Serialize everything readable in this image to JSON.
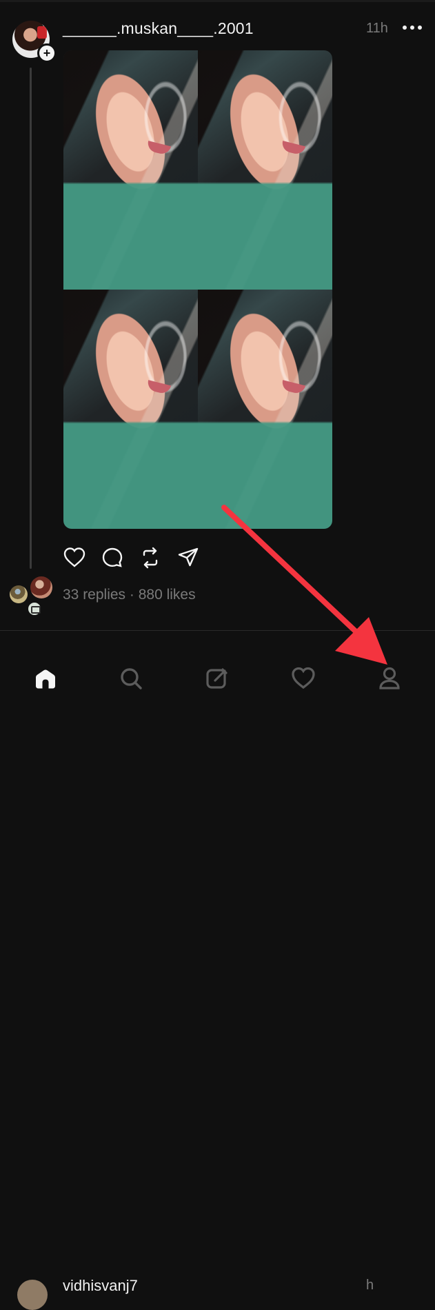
{
  "post": {
    "username": "______.muskan____.2001",
    "timestamp": "11h",
    "stats": "33 replies · 880 likes",
    "more_icon": "more-icon"
  },
  "next_post": {
    "username": "vidhisvanj7",
    "timestamp": "h"
  },
  "icons": {
    "like": "heart-icon",
    "reply": "comment-icon",
    "repost": "repost-icon",
    "share": "send-icon",
    "home": "home-icon",
    "search": "search-icon",
    "compose": "compose-icon",
    "activity": "heart-icon",
    "profile": "profile-icon"
  },
  "colors": {
    "background": "#101010",
    "text": "#f3f3f3",
    "muted": "#7a7a7a",
    "annotation_arrow": "#f4343f"
  }
}
